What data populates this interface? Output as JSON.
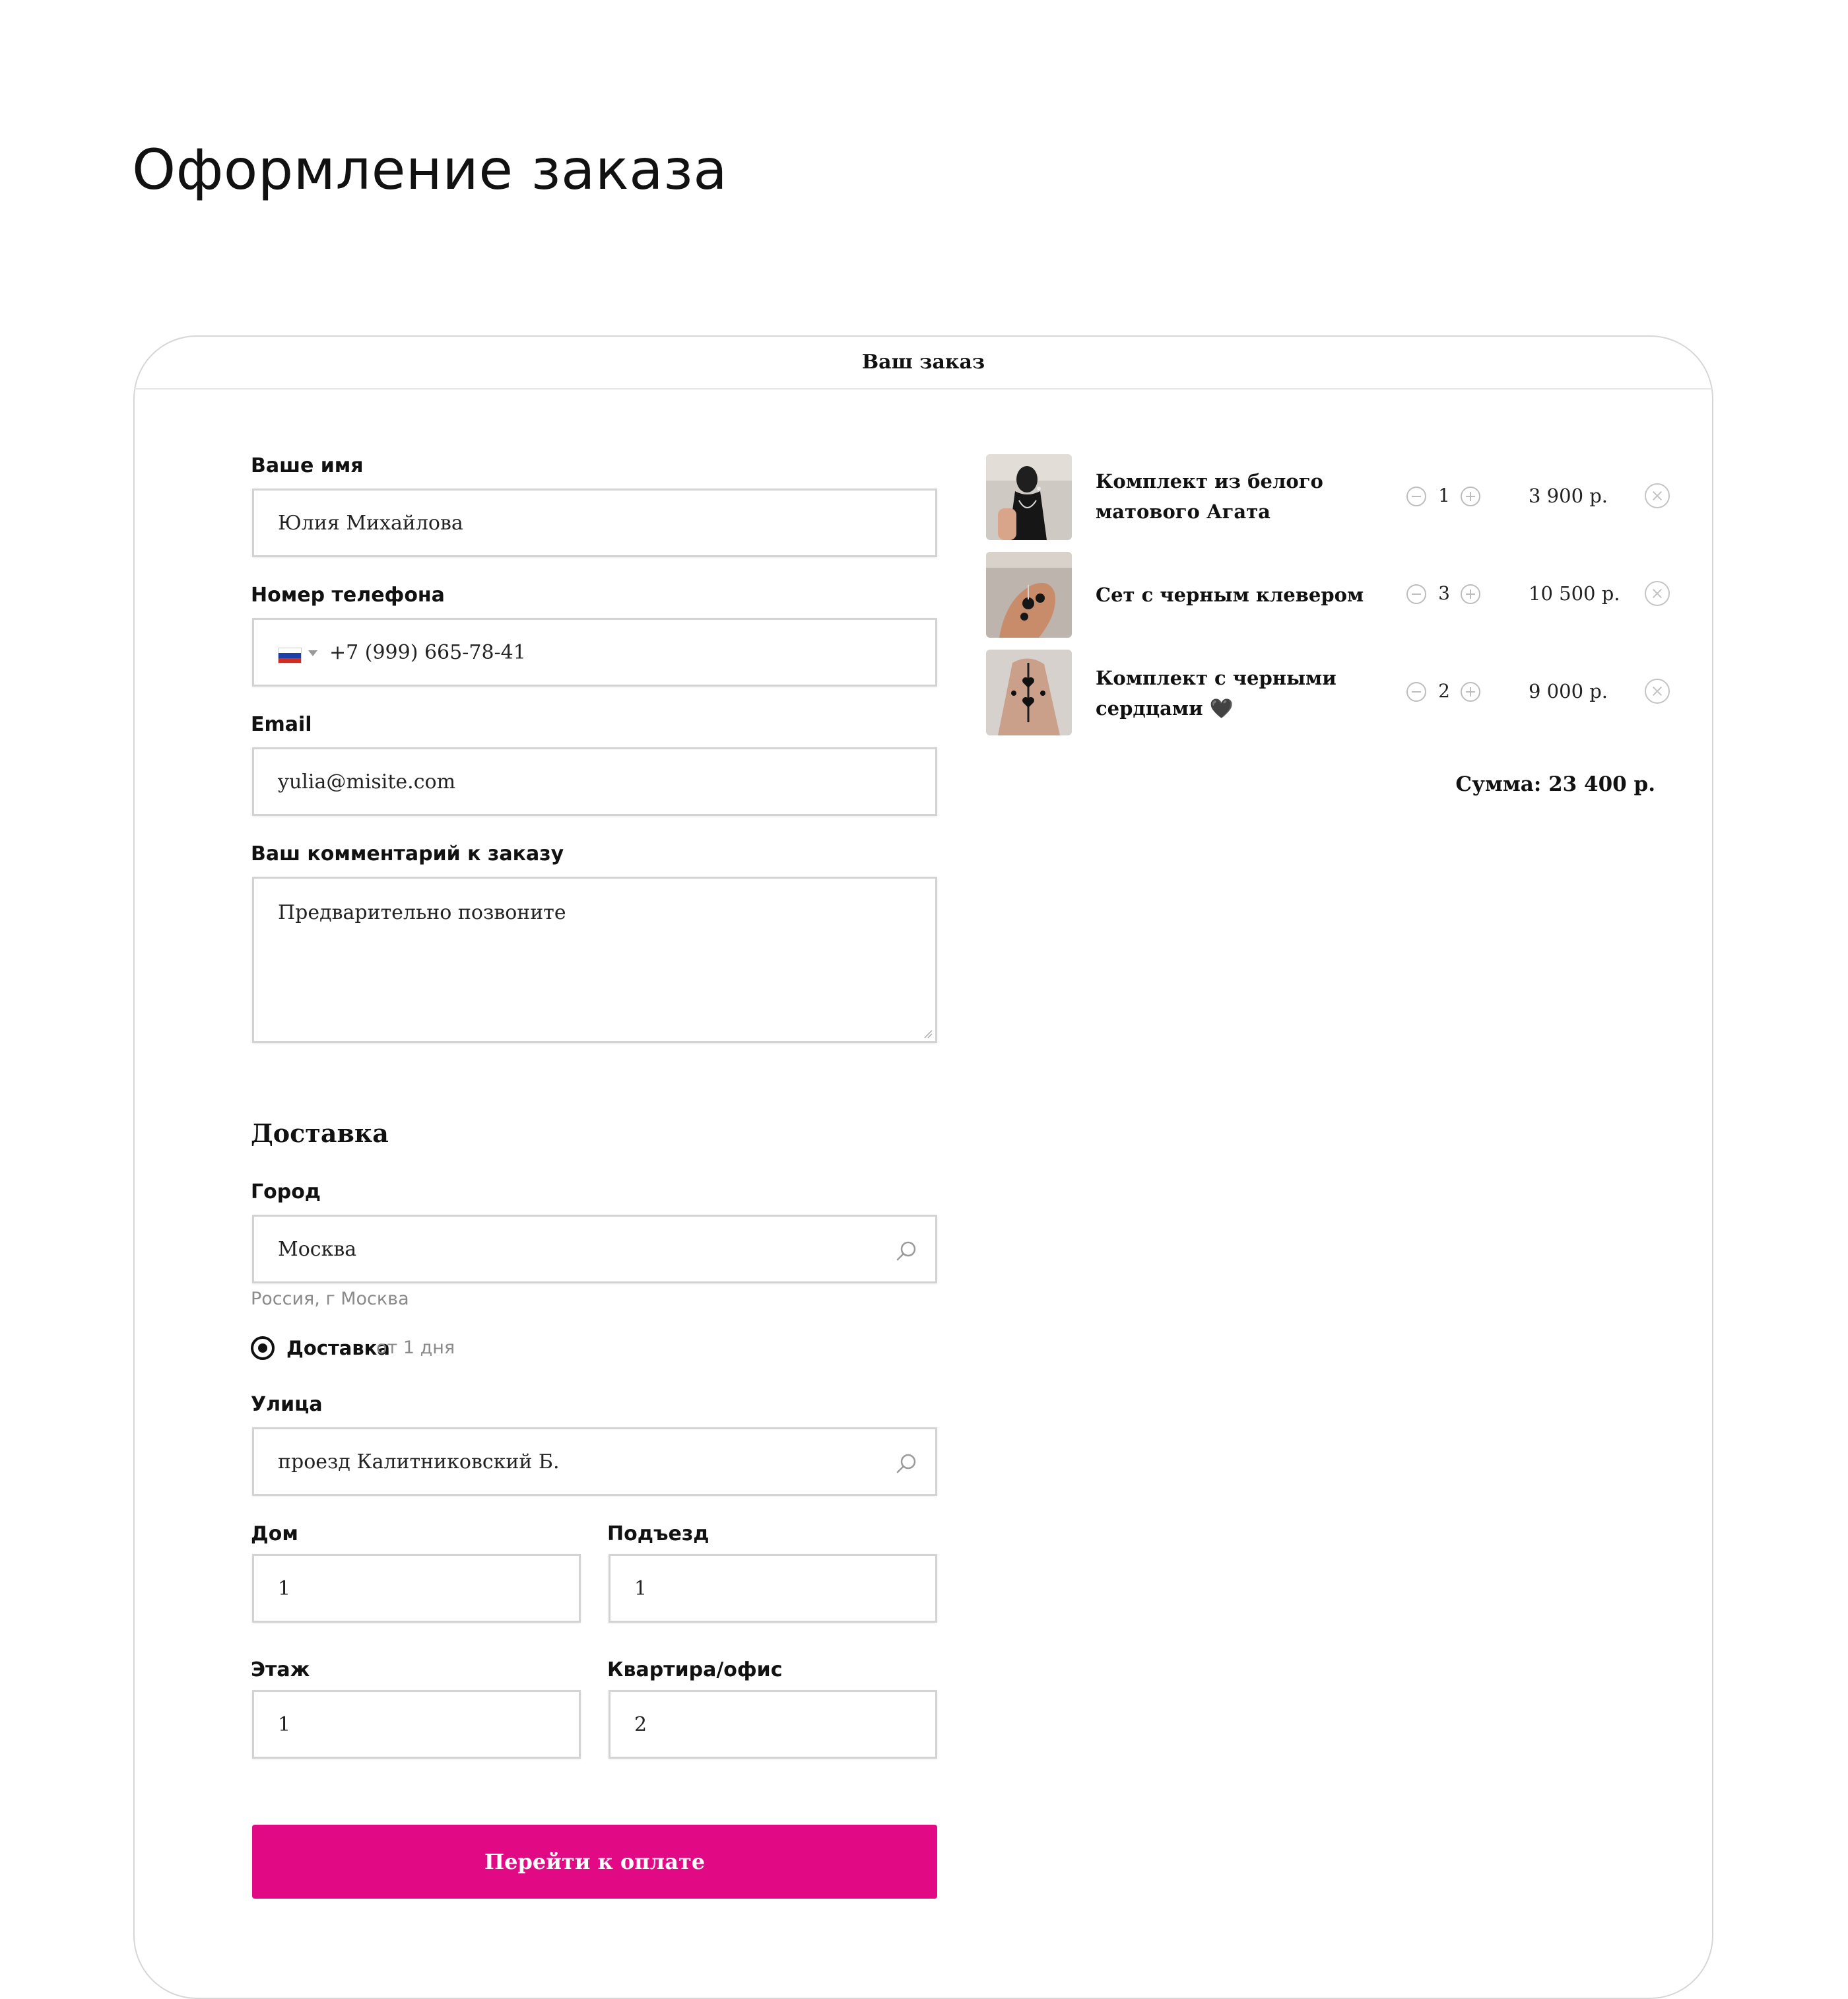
{
  "page": {
    "title": "Оформление заказа"
  },
  "card": {
    "header": "Ваш заказ"
  },
  "form": {
    "name": {
      "label": "Ваше имя",
      "value": "Юлия Михайлова"
    },
    "phone": {
      "label": "Номер телефона",
      "value": "+7 (999) 665-78-41",
      "country": "RU",
      "flag_colors": [
        "#ffffff",
        "#1c3fa8",
        "#d52b1e"
      ]
    },
    "email": {
      "label": "Email",
      "value": "yulia@misite.com"
    },
    "comment": {
      "label": "Ваш комментарий к заказу",
      "value": "Предварительно позвоните"
    },
    "delivery": {
      "title": "Доставка",
      "city": {
        "label": "Город",
        "value": "Москва",
        "hint": "Россия, г Москва"
      },
      "method": {
        "label": "Доставка",
        "sub": "от 1 дня",
        "selected": true
      },
      "street": {
        "label": "Улица",
        "value": "проезд Калитниковский Б."
      },
      "house": {
        "label": "Дом",
        "value": "1"
      },
      "entrance": {
        "label": "Подъезд",
        "value": "1"
      },
      "floor": {
        "label": "Этаж",
        "value": "1"
      },
      "apartment": {
        "label": "Квартира/офис",
        "value": "2"
      }
    },
    "submit_label": "Перейти к оплате"
  },
  "cart": {
    "items": [
      {
        "name": "Комплект из белого матового Агата",
        "qty": "1",
        "price": "3 900 р."
      },
      {
        "name": "Сет с черным клевером",
        "qty": "3",
        "price": "10 500 р."
      },
      {
        "name": "Комплект с черными сердцами 🖤",
        "qty": "2",
        "price": "9 000 р."
      }
    ],
    "total": "Сумма: 23 400 р."
  },
  "colors": {
    "accent": "#e10a84",
    "border": "#d3d3d3",
    "muted": "#8a8a8a"
  },
  "icons": [
    "search-icon",
    "minus-icon",
    "plus-icon",
    "close-icon",
    "flag-ru-icon",
    "chevron-down-icon"
  ]
}
